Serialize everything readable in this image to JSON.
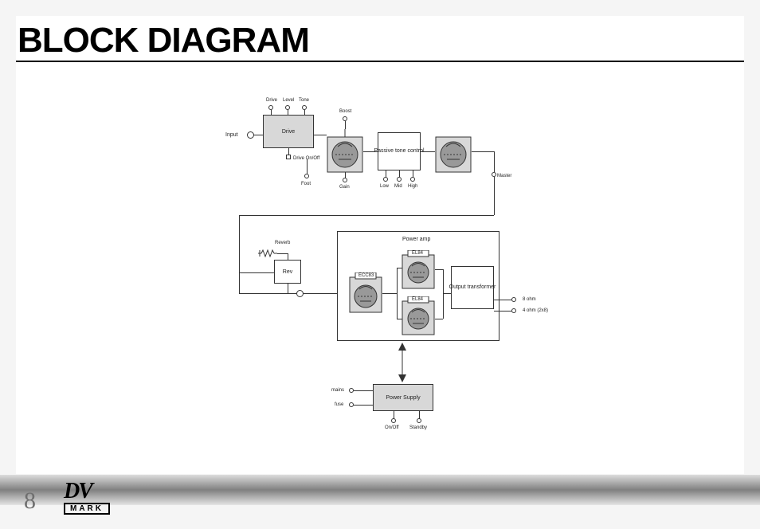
{
  "title": "BLOCK DIAGRAM",
  "page_number": "8",
  "logo": {
    "top": "DV",
    "bottom": "MARK"
  },
  "diagram": {
    "input": "Input",
    "drive_knobs": {
      "drive": "Drive",
      "level": "Level",
      "tone": "Tone"
    },
    "drive_box": "Drive",
    "drive_switch": "Drive On/Off",
    "foot": "Foot",
    "boost": "Boost",
    "gain": "Gain",
    "passive_tone": "Passive tone control",
    "eq": {
      "low": "Low",
      "mid": "Mid",
      "high": "High"
    },
    "master": "Master",
    "reverb": "Reverb",
    "rev_box": "Rev",
    "power_amp": "Power amp",
    "tubes": {
      "ecc83": "ECC83",
      "el84_top": "EL84",
      "el84_bottom": "EL84"
    },
    "output_transformer": "Output transformer",
    "outputs": {
      "eight": "8 ohm",
      "four": "4 ohm (2x8)"
    },
    "power_supply": "Power Supply",
    "mains": "mains",
    "fuse": "fuse",
    "onoff": "On/Off",
    "standby": "Standby"
  }
}
